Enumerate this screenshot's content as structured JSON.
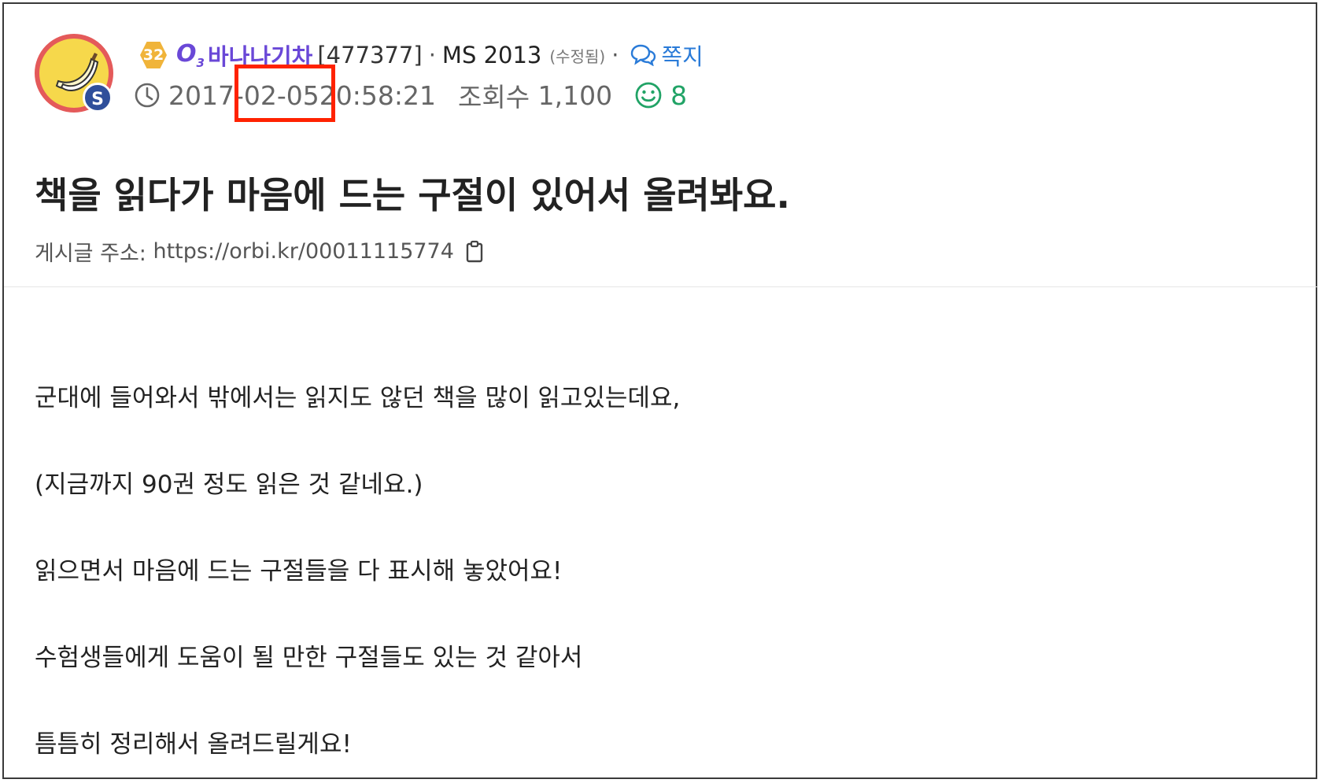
{
  "post": {
    "author": {
      "level": "32",
      "badge": "S",
      "grade_icon": "O3",
      "name": "바나나기차",
      "id": "[477377]",
      "class": "MS 2013",
      "edited": "(수정됨)",
      "message_label": "쪽지"
    },
    "meta": {
      "date_prefix": "2017-",
      "date_highlight": "02-05",
      "time": " 20:58:21",
      "views_label": "조회수",
      "views": "1,100",
      "likes": "8"
    },
    "title": "책을 읽다가 마음에 드는 구절이 있어서 올려봐요.",
    "url_label": "게시글 주소:",
    "url": "https://orbi.kr/00011115774",
    "body": [
      "군대에 들어와서 밖에서는 읽지도 않던 책을 많이 읽고있는데요,",
      "(지금까지 90권 정도 읽은 것 같네요.)",
      "읽으면서 마음에 드는 구절들을 다 표시해 놓았어요!",
      "수험생들에게 도움이 될 만한 구절들도 있는 것 같아서",
      "틈틈히 정리해서 올려드릴게요!"
    ]
  },
  "icons": [
    "banana-avatar-icon",
    "level-badge-icon",
    "grade-o3-icon",
    "message-icon",
    "clock-icon",
    "smile-icon",
    "clipboard-icon"
  ],
  "colors": {
    "username": "#6a48d7",
    "link": "#2a7bd8",
    "like": "#21a366",
    "highlight": "#ff2200",
    "level": "#f0b43a"
  }
}
